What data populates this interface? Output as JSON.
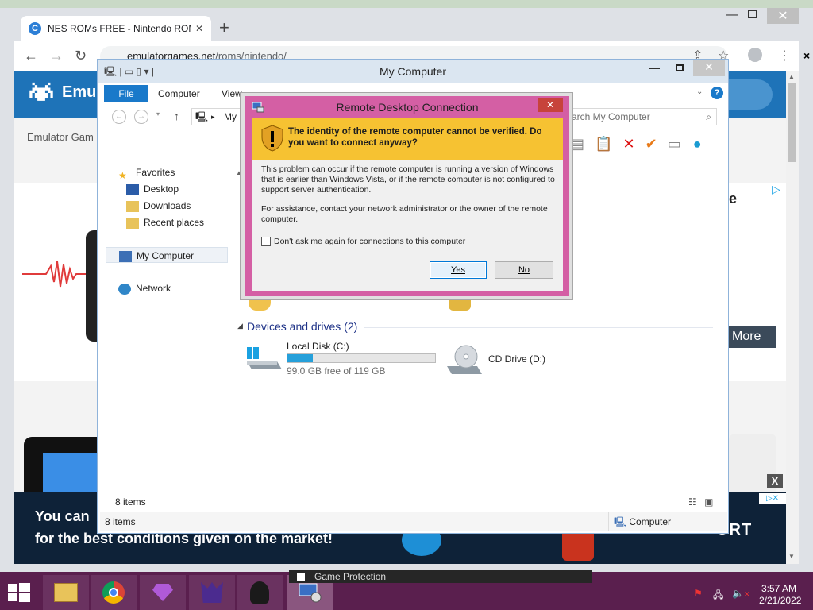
{
  "browser": {
    "tab_title": "NES ROMs FREE - Nintendo ROM",
    "tab_favicon_letter": "C",
    "url_domain": "emulatorgames.net",
    "url_path": "/roms/nintendo/"
  },
  "website": {
    "brand": "Emul",
    "breadcrumb": "Emulator Gam",
    "ad_partial_text": "e",
    "more_label": "More",
    "ad_line1": "You can",
    "ad_line2": "for the best conditions given on the market!",
    "ad_line3": "ORT",
    "ad_close": "X"
  },
  "explorer": {
    "title": "My Computer",
    "tabs": {
      "file": "File",
      "computer": "Computer",
      "view": "View"
    },
    "address": "My C",
    "search_placeholder": "arch My Computer",
    "nav": {
      "favorites": "Favorites",
      "desktop": "Desktop",
      "downloads": "Downloads",
      "recent": "Recent places",
      "mycomputer": "My Computer",
      "network": "Network"
    },
    "group_header": "Devices and drives (2)",
    "drives": [
      {
        "name": "Local Disk (C:)",
        "free": "99.0 GB free of 119 GB",
        "used_fraction": 0.17
      },
      {
        "name": "CD Drive (D:)"
      }
    ],
    "item_count": "8 items",
    "status_items": "8 items",
    "status_location": "Computer"
  },
  "rdp": {
    "title": "Remote Desktop Connection",
    "warning": "The identity of the remote computer cannot be verified. Do you want to connect anyway?",
    "p1": "This problem can occur if the remote computer is running a version of Windows that is earlier than Windows Vista, or if the remote computer is not configured to support server authentication.",
    "p2": "For assistance, contact your network administrator or the owner of the remote computer.",
    "checkbox_label": "Don't ask me again for connections to this computer",
    "yes": "Yes",
    "no": "No"
  },
  "taskbar": {
    "tooltip": "Game Protection",
    "time": "3:57 AM",
    "date": "2/21/2022"
  },
  "colors": {
    "explorer_accent": "#1979ca",
    "rdp_frame": "#d45fa4",
    "rdp_banner": "#f6c232",
    "taskbar": "#5a1f4e",
    "site_header": "#1e73b8",
    "drive_bar": "#26a0da"
  }
}
